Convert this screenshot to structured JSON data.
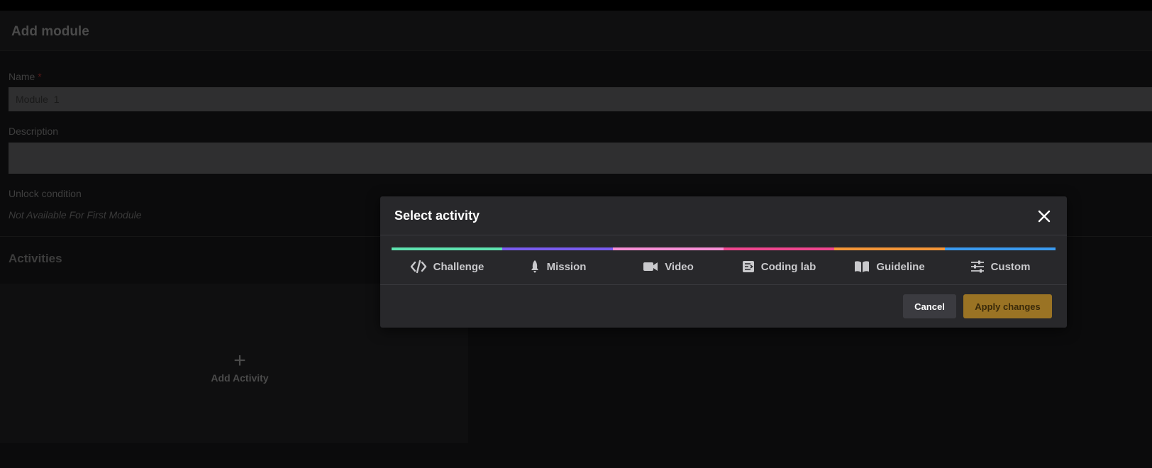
{
  "page": {
    "title": "Add module"
  },
  "form": {
    "name_label": "Name",
    "name_required_mark": "*",
    "name_value": "Module  1",
    "description_label": "Description",
    "description_value": "",
    "unlock_label": "Unlock condition",
    "unlock_value": "Not Available For First Module"
  },
  "activities": {
    "title": "Activities",
    "add_plus": "+",
    "add_label": "Add Activity"
  },
  "modal": {
    "title": "Select activity",
    "close_icon": "close-icon",
    "options": [
      {
        "label": "Challenge",
        "icon": "code-icon",
        "color": "#5ee3b0"
      },
      {
        "label": "Mission",
        "icon": "rocket-icon",
        "color": "#7a5cf0"
      },
      {
        "label": "Video",
        "icon": "video-camera-icon",
        "color": "#f78fd6"
      },
      {
        "label": "Coding lab",
        "icon": "coding-lab-icon",
        "color": "#f0468f"
      },
      {
        "label": "Guideline",
        "icon": "book-icon",
        "color": "#f59638"
      },
      {
        "label": "Custom",
        "icon": "sliders-icon",
        "color": "#3a9af0"
      }
    ],
    "cancel_label": "Cancel",
    "apply_label": "Apply changes"
  },
  "colors": {
    "accent": "#9a7324",
    "modal_bg": "#28282b",
    "page_bg": "#0b0b0c"
  }
}
